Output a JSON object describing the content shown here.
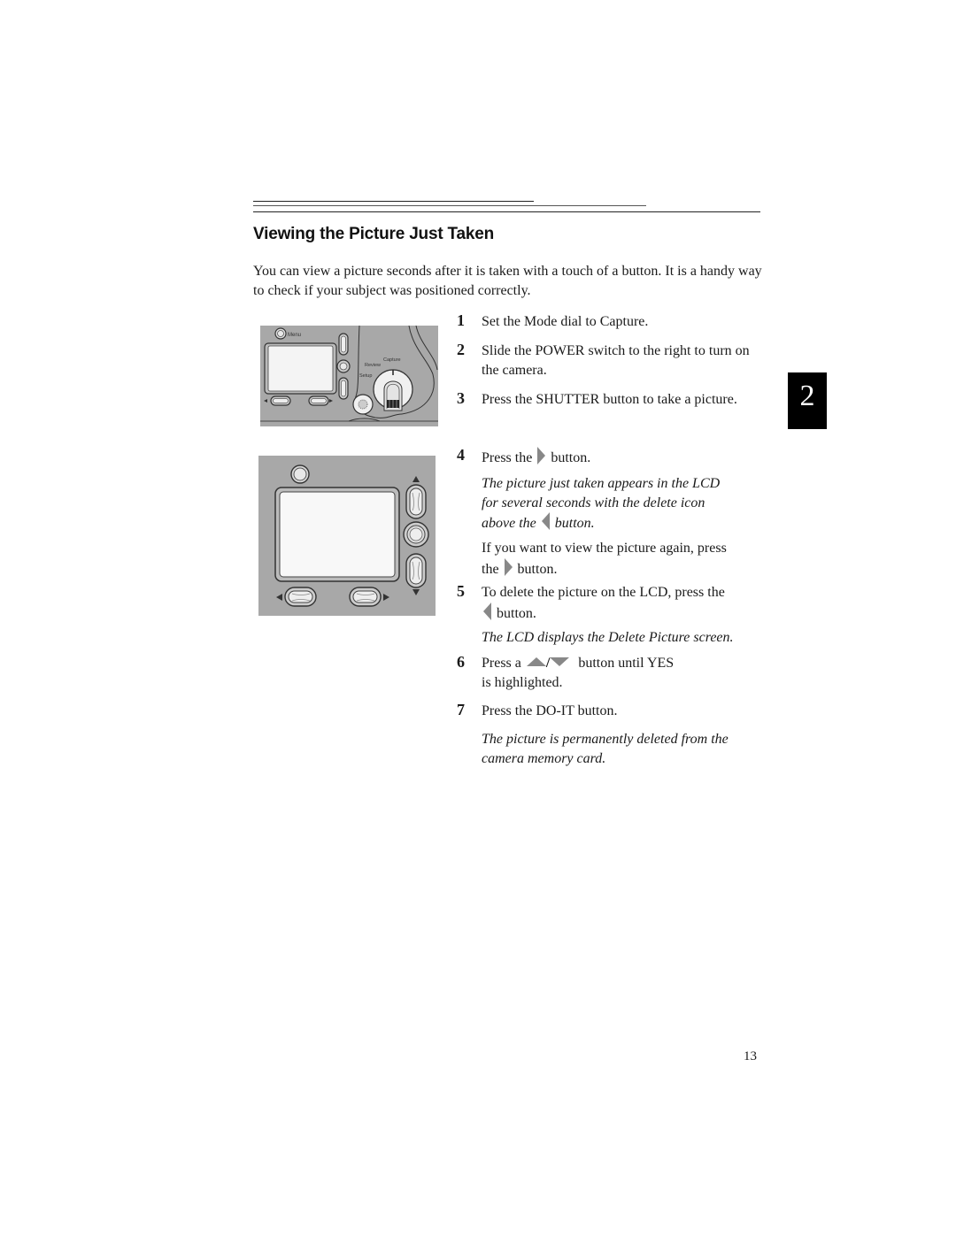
{
  "header": {
    "title": "Viewing the Picture Just Taken"
  },
  "intro": "You can view a picture seconds after it is taken with a touch of a button. It is a handy way to check if your subject was positioned correctly.",
  "figures": {
    "camera_back": {
      "menu_label": "Menu",
      "dial_labels": [
        "Capture",
        "Review",
        "Setup"
      ]
    }
  },
  "steps": [
    {
      "number": "1",
      "text": "Set the Mode dial to Capture."
    },
    {
      "number": "2",
      "text": "Slide the POWER switch to the right to turn on the camera."
    },
    {
      "number": "3",
      "text": "Press the SHUTTER button to take a picture."
    },
    {
      "number": "4",
      "text_before": "Press the",
      "icon": "right-arrow-icon",
      "text_after": "button.",
      "note": {
        "line1": "The picture just taken appears in the LCD",
        "line2": "for several seconds with the delete icon",
        "before": "above the",
        "icon": "left-arrow-icon",
        "after": "button."
      },
      "extra": {
        "line1": "If you want to view the picture again, press",
        "before": "the",
        "icon": "right-arrow-icon",
        "after": "button."
      }
    },
    {
      "number": "5",
      "text": "To delete the picture on the LCD, press the",
      "icon": "left-arrow-icon",
      "text_after": "button.",
      "note": "The LCD displays the Delete Picture screen."
    },
    {
      "number": "6",
      "text_before": "Press a",
      "icon": "up-down-arrow-icon",
      "separator": "/",
      "text_after": "button until YES",
      "line2": "is highlighted."
    },
    {
      "number": "7",
      "text": "Press the DO-IT button.",
      "note": "The picture is permanently deleted from the camera memory card."
    }
  ],
  "chapter_tab": "2",
  "page_number": "13"
}
